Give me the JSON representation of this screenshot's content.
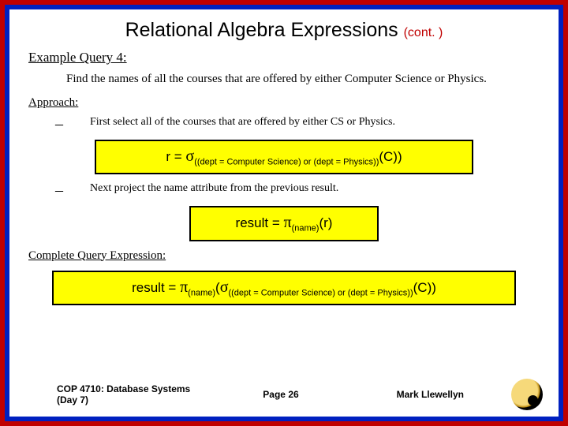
{
  "title_main": "Relational Algebra Expressions",
  "title_cont": "(cont. )",
  "example_heading": "Example Query 4:",
  "example_body": "Find the names of all the courses that are offered by either Computer Science or Physics.",
  "approach_heading": "Approach:",
  "step1": "First select all of the courses that are offered by either CS or Physics.",
  "step2": "Next project the name attribute from the previous result.",
  "formula1": {
    "lhs": "r = ",
    "op": "σ",
    "sub": "((dept = Computer Science) or (dept = Physics))",
    "arg": "(C))"
  },
  "formula2": {
    "lhs": "result = ",
    "op": "π",
    "sub": "(name)",
    "arg": "(r)"
  },
  "complete_heading": "Complete Query Expression:",
  "formula3": {
    "lhs": "result = ",
    "op1": "π",
    "sub1": "(name)",
    "mid": "(",
    "op2": "σ",
    "sub2": "((dept = Computer Science) or (dept = Physics))",
    "arg": "(C))"
  },
  "footer": {
    "course": "COP 4710: Database Systems (Day 7)",
    "page": "Page 26",
    "author": "Mark Llewellyn"
  }
}
